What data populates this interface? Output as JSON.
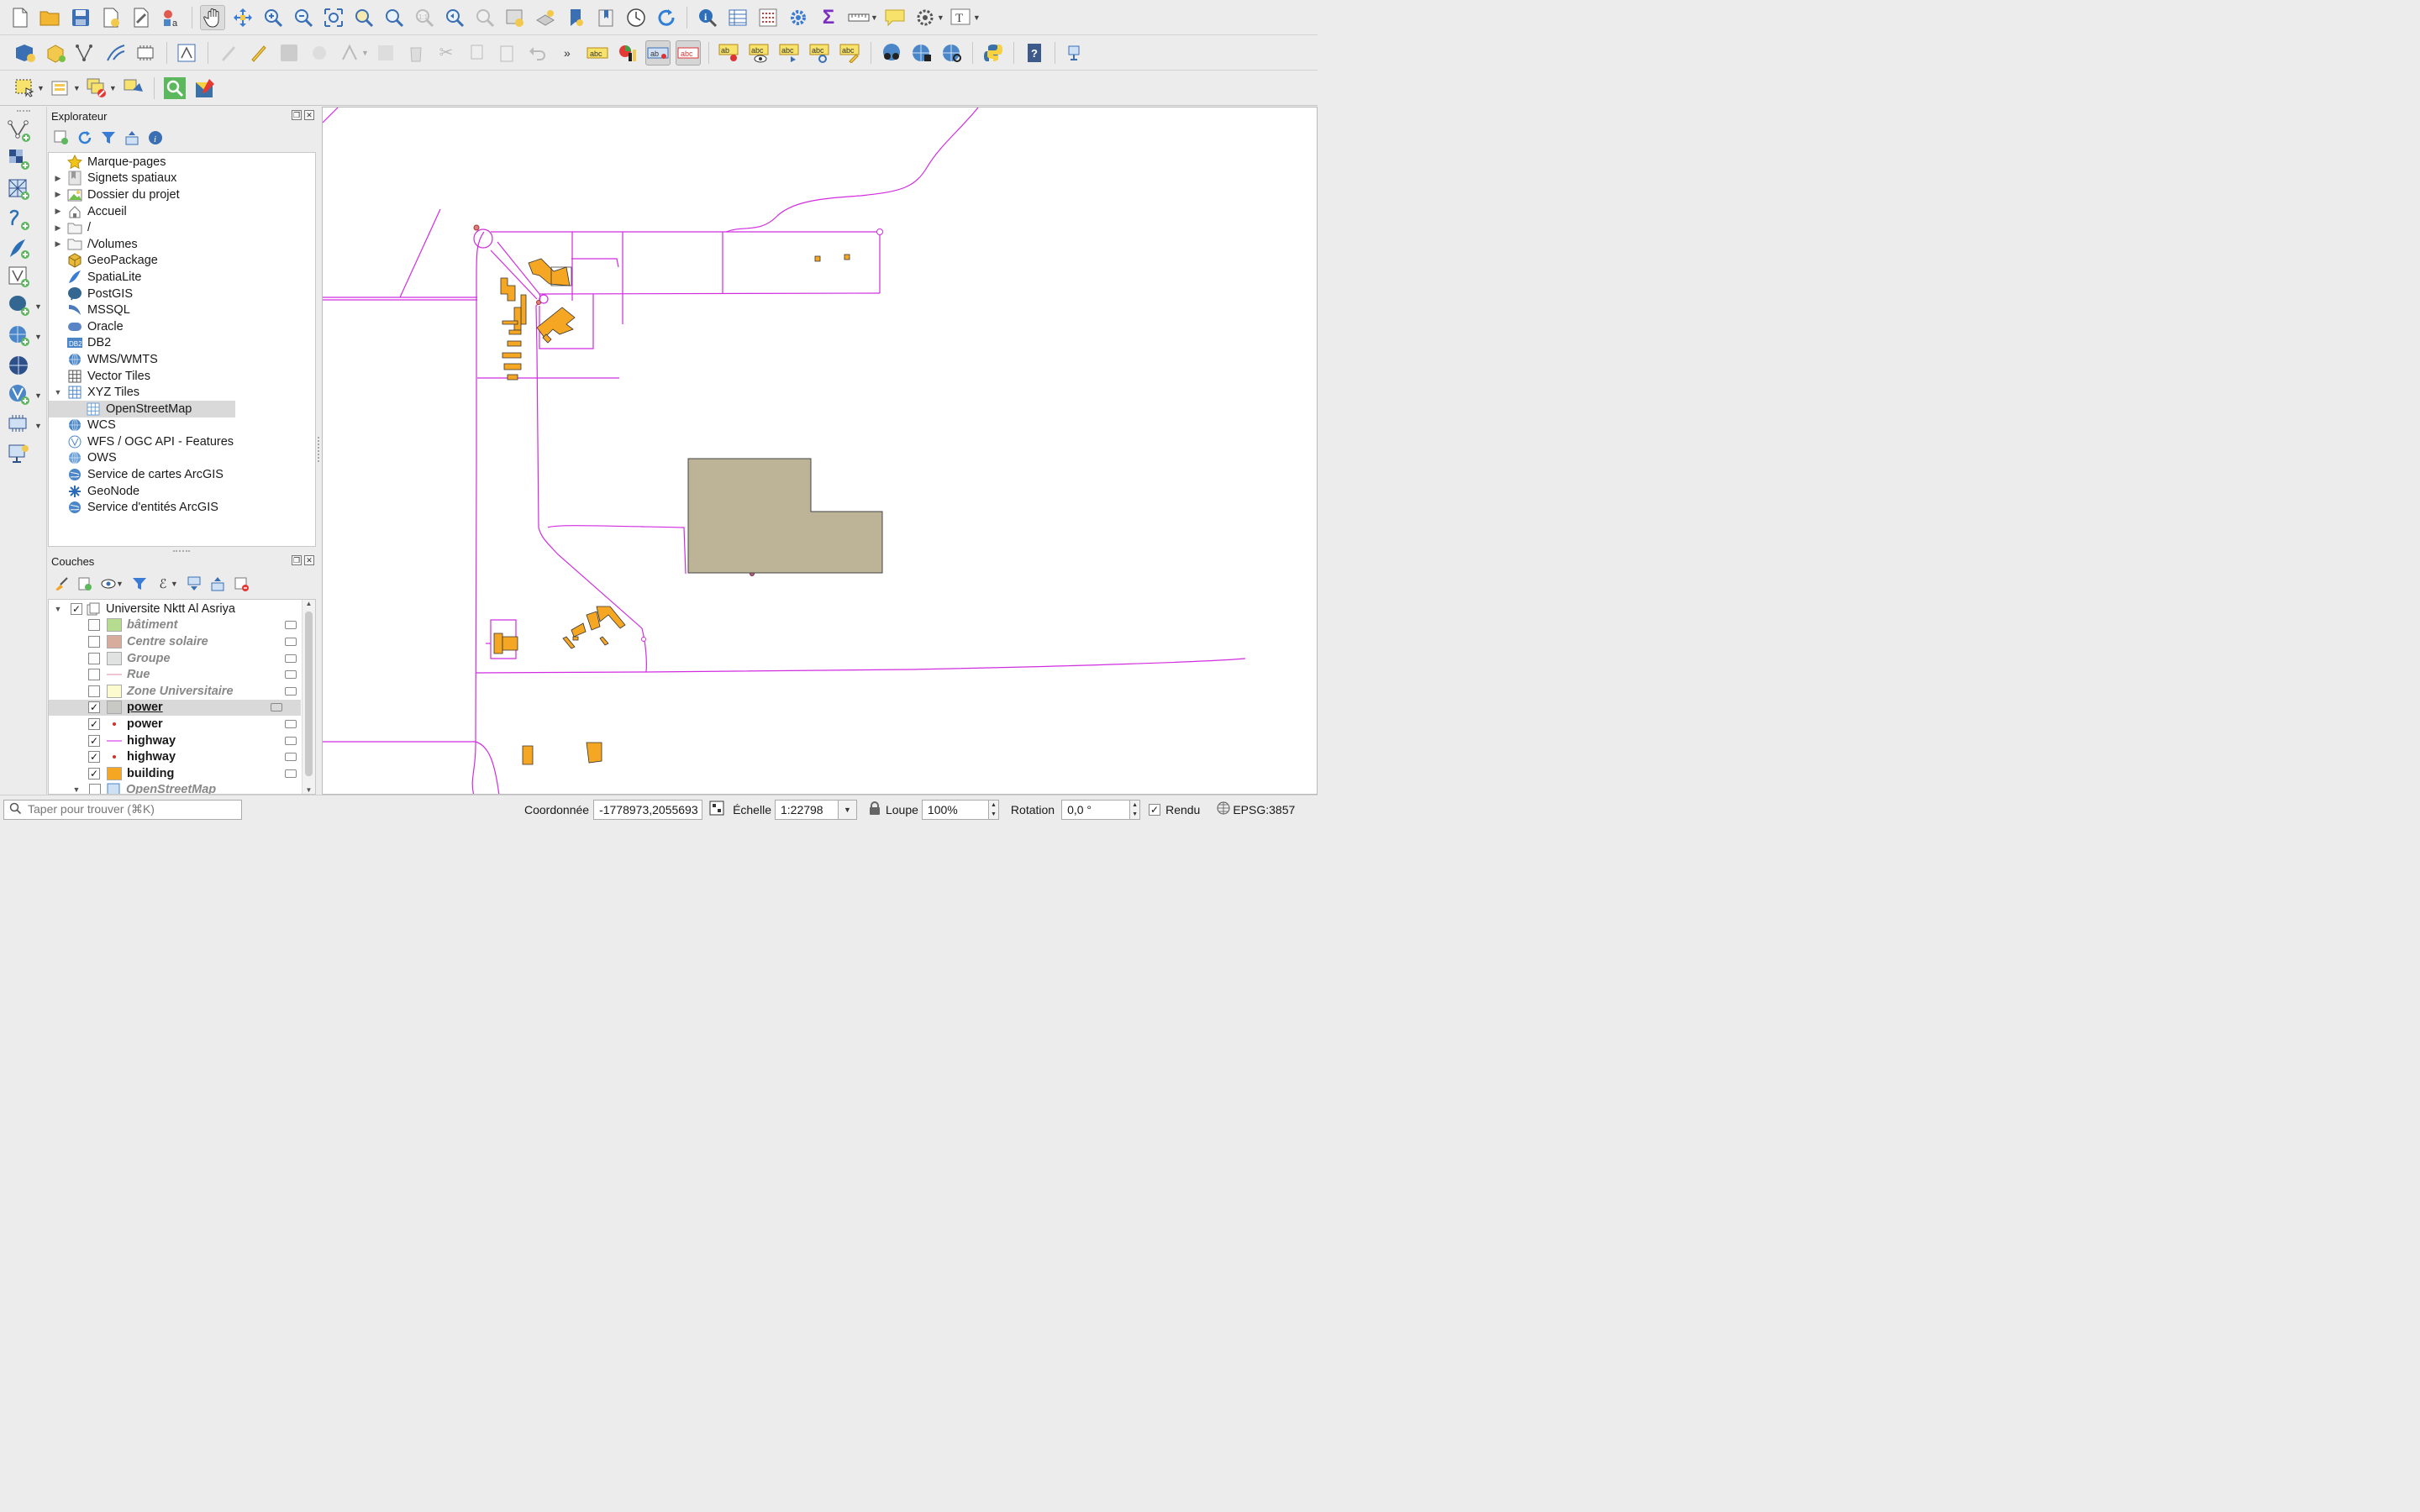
{
  "explorer": {
    "title": "Explorateur",
    "items": [
      {
        "label": "Marque-pages",
        "expandable": false,
        "icon": "star-icon",
        "color": "#f0c419"
      },
      {
        "label": "Signets spatiaux",
        "expandable": true,
        "icon": "bookmark-icon",
        "color": "#999999"
      },
      {
        "label": "Dossier du projet",
        "expandable": true,
        "icon": "project-folder-icon",
        "color": "#6fbf4a"
      },
      {
        "label": "Accueil",
        "expandable": true,
        "icon": "home-icon",
        "color": "#777777"
      },
      {
        "label": "/",
        "expandable": true,
        "icon": "folder-icon",
        "color": "#888888"
      },
      {
        "label": "/Volumes",
        "expandable": true,
        "icon": "folder-icon",
        "color": "#888888"
      },
      {
        "label": "GeoPackage",
        "expandable": false,
        "icon": "geopackage-icon",
        "color": "#e8b93a"
      },
      {
        "label": "SpatiaLite",
        "expandable": false,
        "icon": "spatialite-icon",
        "color": "#3a7bd5"
      },
      {
        "label": "PostGIS",
        "expandable": false,
        "icon": "postgis-icon",
        "color": "#336791"
      },
      {
        "label": "MSSQL",
        "expandable": false,
        "icon": "mssql-icon",
        "color": "#4a7ab8"
      },
      {
        "label": "Oracle",
        "expandable": false,
        "icon": "oracle-icon",
        "color": "#5b84c7"
      },
      {
        "label": "DB2",
        "expandable": false,
        "icon": "db2-icon",
        "color": "#4a86c8"
      },
      {
        "label": "WMS/WMTS",
        "expandable": false,
        "icon": "globe-icon",
        "color": "#4a86c8"
      },
      {
        "label": "Vector Tiles",
        "expandable": false,
        "icon": "grid-icon",
        "color": "#555555"
      },
      {
        "label": "XYZ Tiles",
        "expandable": "open",
        "icon": "grid-icon",
        "color": "#4a86c8"
      },
      {
        "label": "OpenStreetMap",
        "expandable": "child",
        "icon": "grid-icon",
        "color": "#6aa0d8"
      },
      {
        "label": "WCS",
        "expandable": false,
        "icon": "globe-icon",
        "color": "#4a86c8"
      },
      {
        "label": "WFS / OGC API - Features",
        "expandable": false,
        "icon": "wfs-icon",
        "color": "#4a86c8"
      },
      {
        "label": "OWS",
        "expandable": false,
        "icon": "globe-icon",
        "color": "#6aa0d8"
      },
      {
        "label": "Service de cartes ArcGIS",
        "expandable": false,
        "icon": "arcgis-globe-icon",
        "color": "#4a86c8"
      },
      {
        "label": "GeoNode",
        "expandable": false,
        "icon": "geonode-icon",
        "color": "#2a6bb8"
      },
      {
        "label": "Service d'entités ArcGIS",
        "expandable": false,
        "icon": "arcgis-globe-icon",
        "color": "#4a86c8"
      }
    ]
  },
  "layers": {
    "title": "Couches",
    "group": "Universite Nktt Al Asriya",
    "items": [
      {
        "label": "bâtiment",
        "checked": false,
        "swatch": "fill",
        "color": "#b5dc8f"
      },
      {
        "label": "Centre solaire",
        "checked": false,
        "swatch": "fill",
        "color": "#d8ac9d"
      },
      {
        "label": "Groupe",
        "checked": false,
        "swatch": "fill",
        "color": "#e1e3e3"
      },
      {
        "label": "Rue",
        "checked": false,
        "swatch": "line",
        "color": "#e6a0b4"
      },
      {
        "label": "Zone Universitaire",
        "checked": false,
        "swatch": "fill",
        "color": "#fbfbcf"
      },
      {
        "label": "power",
        "checked": true,
        "swatch": "fill",
        "color": "#c8c8c4",
        "selected": true
      },
      {
        "label": "power",
        "checked": true,
        "swatch": "point",
        "color": "#cc3333"
      },
      {
        "label": "highway",
        "checked": true,
        "swatch": "line",
        "color": "#d946ef"
      },
      {
        "label": "highway",
        "checked": true,
        "swatch": "point",
        "color": "#cc3333"
      },
      {
        "label": "building",
        "checked": true,
        "swatch": "fill",
        "color": "#f5a623"
      }
    ],
    "osm": "OpenStreetMap"
  },
  "status": {
    "search_placeholder": "Taper pour trouver (⌘K)",
    "coord_label": "Coordonnée",
    "coord_value": "-1778973,2055693",
    "scale_label": "Échelle",
    "scale_value": "1:22798",
    "magnifier_label": "Loupe",
    "magnifier_value": "100%",
    "rotation_label": "Rotation",
    "rotation_value": "0,0 °",
    "render_label": "Rendu",
    "crs": "EPSG:3857"
  },
  "map_colors": {
    "road": "#d12ce0",
    "building": "#f5a623",
    "power_area": "#bdb396"
  }
}
